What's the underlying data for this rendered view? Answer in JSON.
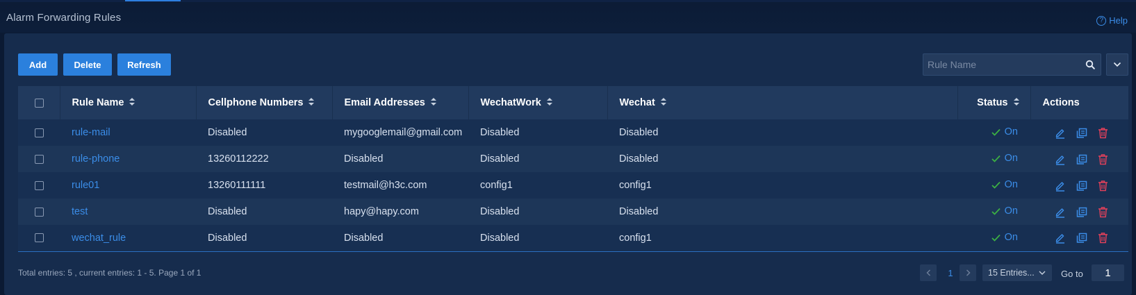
{
  "header": {
    "title": "Alarm Forwarding Rules",
    "help_label": "Help"
  },
  "toolbar": {
    "add_label": "Add",
    "delete_label": "Delete",
    "refresh_label": "Refresh",
    "search_placeholder": "Rule Name",
    "search_value": ""
  },
  "table": {
    "columns": [
      "Rule Name",
      "Cellphone Numbers",
      "Email Addresses",
      "WechatWork",
      "Wechat",
      "Status",
      "Actions"
    ],
    "rows": [
      {
        "name": "rule-mail",
        "cellphone": "Disabled",
        "email": "mygooglemail@gmail.com",
        "wechatwork": "Disabled",
        "wechat": "Disabled",
        "status": "On"
      },
      {
        "name": "rule-phone",
        "cellphone": "13260112222",
        "email": "Disabled",
        "wechatwork": "Disabled",
        "wechat": "Disabled",
        "status": "On"
      },
      {
        "name": "rule01",
        "cellphone": "13260111111",
        "email": "testmail@h3c.com",
        "wechatwork": "config1",
        "wechat": "config1",
        "status": "On"
      },
      {
        "name": "test",
        "cellphone": "Disabled",
        "email": "hapy@hapy.com",
        "wechatwork": "Disabled",
        "wechat": "Disabled",
        "status": "On"
      },
      {
        "name": "wechat_rule",
        "cellphone": "Disabled",
        "email": "Disabled",
        "wechatwork": "Disabled",
        "wechat": "config1",
        "status": "On"
      }
    ]
  },
  "footer": {
    "summary": "Total entries: 5 , current entries: 1 - 5. Page 1 of 1",
    "current_page": "1",
    "page_size": "15 Entries...",
    "goto_label": "Go to",
    "goto_value": "1"
  },
  "colors": {
    "background": "#0b1a33",
    "panel": "#162c4d",
    "primary": "#2b80dd",
    "link": "#3b8de8",
    "success": "#3cb043",
    "danger": "#e0405a"
  },
  "icons": {
    "help": "help-circle-icon",
    "search": "search-icon",
    "dropdown": "chevron-down-icon",
    "sort": "sort-icon",
    "status_check": "check-icon",
    "edit": "edit-icon",
    "copy": "copy-icon",
    "delete": "trash-icon"
  }
}
